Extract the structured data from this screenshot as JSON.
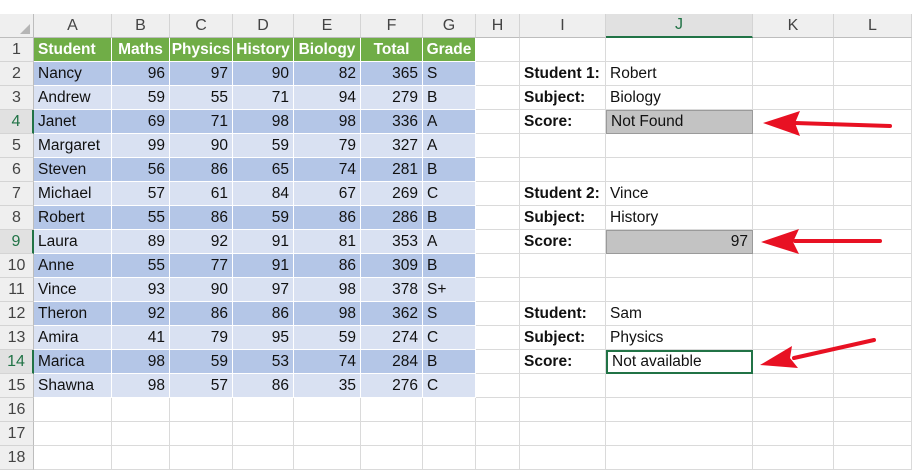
{
  "columns": [
    "A",
    "B",
    "C",
    "D",
    "E",
    "F",
    "G",
    "H",
    "I",
    "J",
    "K",
    "L"
  ],
  "rows": [
    "1",
    "2",
    "3",
    "4",
    "5",
    "6",
    "7",
    "8",
    "9",
    "10",
    "11",
    "12",
    "13",
    "14",
    "15",
    "16",
    "17",
    "18"
  ],
  "table": {
    "headers": [
      "Student",
      "Maths",
      "Physics",
      "History",
      "Biology",
      "Total",
      "Grade"
    ],
    "data": [
      [
        "Nancy",
        "96",
        "97",
        "90",
        "82",
        "365",
        "S"
      ],
      [
        "Andrew",
        "59",
        "55",
        "71",
        "94",
        "279",
        "B"
      ],
      [
        "Janet",
        "69",
        "71",
        "98",
        "98",
        "336",
        "A"
      ],
      [
        "Margaret",
        "99",
        "90",
        "59",
        "79",
        "327",
        "A"
      ],
      [
        "Steven",
        "56",
        "86",
        "65",
        "74",
        "281",
        "B"
      ],
      [
        "Michael",
        "57",
        "61",
        "84",
        "67",
        "269",
        "C"
      ],
      [
        "Robert",
        "55",
        "86",
        "59",
        "86",
        "286",
        "B"
      ],
      [
        "Laura",
        "89",
        "92",
        "91",
        "81",
        "353",
        "A"
      ],
      [
        "Anne",
        "55",
        "77",
        "91",
        "86",
        "309",
        "B"
      ],
      [
        "Vince",
        "93",
        "90",
        "97",
        "98",
        "378",
        "S+"
      ],
      [
        "Theron",
        "92",
        "86",
        "86",
        "98",
        "362",
        "S"
      ],
      [
        "Amira",
        "41",
        "79",
        "95",
        "59",
        "274",
        "C"
      ],
      [
        "Marica",
        "98",
        "59",
        "53",
        "74",
        "284",
        "B"
      ],
      [
        "Shawna",
        "98",
        "57",
        "86",
        "35",
        "276",
        "C"
      ]
    ]
  },
  "lookup1": {
    "student_label": "Student 1:",
    "student": "Robert",
    "subject_label": "Subject:",
    "subject": "Biology",
    "score_label": "Score:",
    "score": "Not Found"
  },
  "lookup2": {
    "student_label": "Student 2:",
    "student": "Vince",
    "subject_label": "Subject:",
    "subject": "History",
    "score_label": "Score:",
    "score": "97"
  },
  "lookup3": {
    "student_label": "Student:",
    "student": "Sam",
    "subject_label": "Subject:",
    "subject": "Physics",
    "score_label": "Score:",
    "score": "Not available"
  },
  "colors": {
    "header_green": "#70ad47",
    "band_dark": "#b4c6e7",
    "band_light": "#d9e1f2",
    "arrow_red": "#e81123",
    "selection_green": "#217346"
  },
  "selection": {
    "active_column": "J",
    "highlighted_rows": [
      "4",
      "9",
      "14"
    ]
  }
}
